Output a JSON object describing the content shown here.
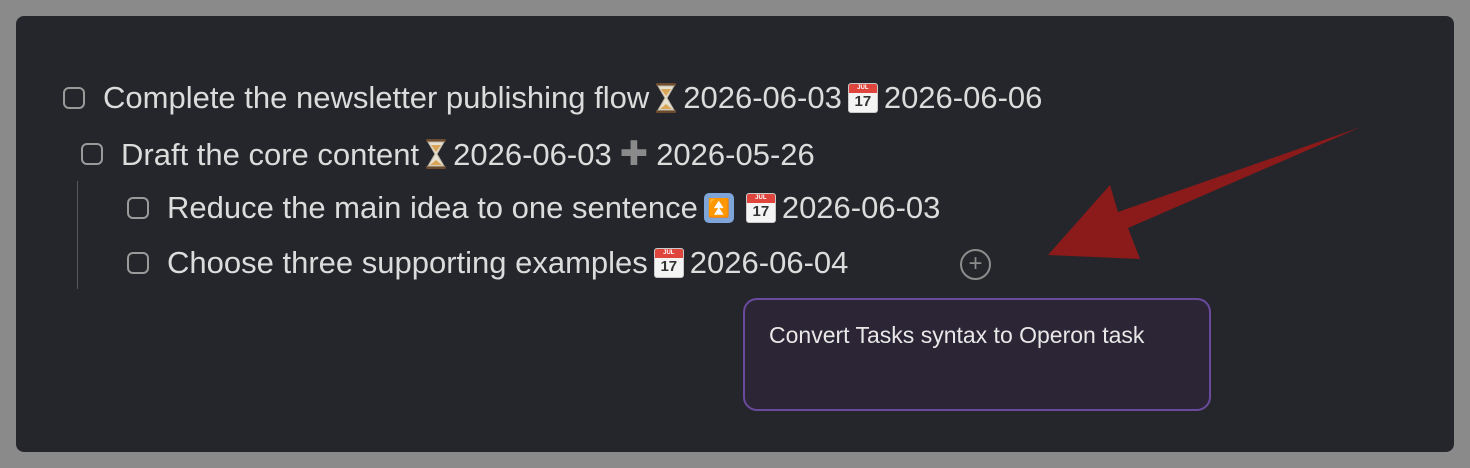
{
  "tasks": [
    {
      "text": "Complete the newsletter publishing flow",
      "scheduled_date": "2026-06-03",
      "due_date": "2026-06-06"
    },
    {
      "text": "Draft the core content",
      "scheduled_date": "2026-06-03",
      "created_date": "2026-05-26"
    },
    {
      "text": "Reduce the main idea to one sentence",
      "priority_icon": "up-arrows-icon",
      "due_date": "2026-06-03"
    },
    {
      "text": "Choose three supporting examples",
      "due_date": "2026-06-04"
    }
  ],
  "calendar_icon": {
    "month": "JUL",
    "day": "17"
  },
  "add_button": {
    "symbol": "+"
  },
  "tooltip": {
    "text": "Convert Tasks syntax to Operon task"
  },
  "colors": {
    "background": "#25262b",
    "text": "#dcdcdc",
    "tooltip_border": "#6a4a9c",
    "arrow": "#8b1a1a"
  }
}
